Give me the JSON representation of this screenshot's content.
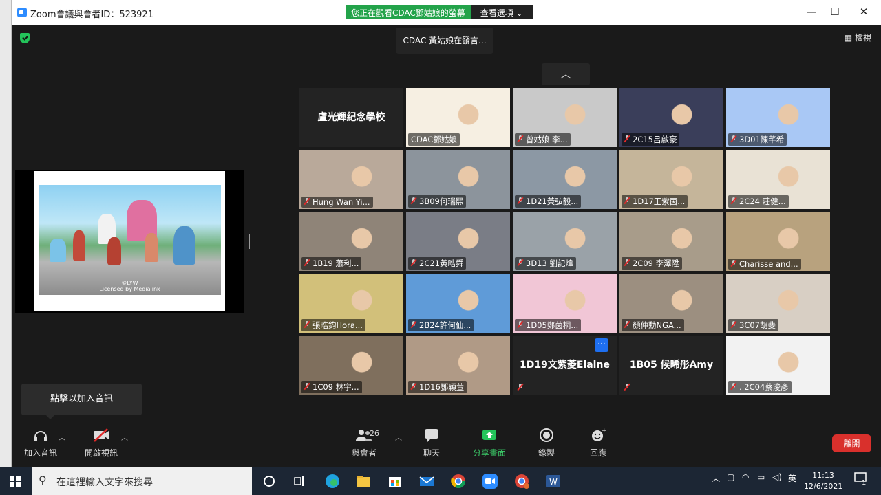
{
  "window": {
    "title": "Zoom會議與會者ID：523921",
    "minimize": "—",
    "maximize": "☐",
    "close": "✕"
  },
  "share_banner": {
    "viewing": "您正在觀看CDAC鄧姑娘的螢幕",
    "options": "查看選項 ⌄"
  },
  "speaking_indicator": "CDAC 黃姑娘在發言...",
  "view_button": "檢視",
  "shared_screen": {
    "caption_line1": "©LYW",
    "caption_line2": "Licensed by Medialink"
  },
  "participants": [
    {
      "name": "盧光輝紀念學校",
      "video": false,
      "muted": false
    },
    {
      "name": "CDAC鄧姑娘",
      "video": true,
      "muted": false,
      "active": true
    },
    {
      "name": "曾姑娘 李...",
      "video": true,
      "muted": true
    },
    {
      "name": "2C15呂啟豪",
      "video": true,
      "muted": true
    },
    {
      "name": "3D01陳芊希",
      "video": true,
      "muted": true
    },
    {
      "name": "Hung Wan Yi...",
      "video": true,
      "muted": true
    },
    {
      "name": "3B09何瑞熙",
      "video": true,
      "muted": true
    },
    {
      "name": "1D21黃弘毅...",
      "video": true,
      "muted": true
    },
    {
      "name": "1D17王紫茵...",
      "video": true,
      "muted": true
    },
    {
      "name": "2C24 莊健...",
      "video": true,
      "muted": true
    },
    {
      "name": "1B19 蕭利...",
      "video": true,
      "muted": true
    },
    {
      "name": "2C21黃晧舜",
      "video": true,
      "muted": true
    },
    {
      "name": "3D13 劉記煒",
      "video": true,
      "muted": true
    },
    {
      "name": "2C09 李澤陞",
      "video": true,
      "muted": true
    },
    {
      "name": "Charisse and...",
      "video": true,
      "muted": true
    },
    {
      "name": "張晧鈞Hora...",
      "video": true,
      "muted": true
    },
    {
      "name": "2B24許何仙...",
      "video": true,
      "muted": true
    },
    {
      "name": "1D05鄭茵桐...",
      "video": true,
      "muted": true
    },
    {
      "name": "顏仲勳NGA...",
      "video": true,
      "muted": true
    },
    {
      "name": "3C07胡斐",
      "video": true,
      "muted": true
    },
    {
      "name": "1C09 林宇...",
      "video": true,
      "muted": true
    },
    {
      "name": "1D16鄧穎萱",
      "video": true,
      "muted": true
    },
    {
      "name": "1D19文紫菱Elaine",
      "video": false,
      "muted": true,
      "more": "···"
    },
    {
      "name": "1B05 候晞彤Amy",
      "video": false,
      "muted": true
    },
    {
      "name": ". 2C04蔡浚彥",
      "video": true,
      "muted": true
    }
  ],
  "audio_tip": "點擊以加入音訊",
  "toolbar": {
    "join_audio": "加入音訊",
    "start_video": "開啟視訊",
    "participants": "與會者",
    "participant_count": "26",
    "chat": "聊天",
    "share_screen": "分享畫面",
    "record": "錄製",
    "reactions": "回應",
    "leave": "離開"
  },
  "taskbar": {
    "search_placeholder": "在這裡輸入文字來搜尋",
    "ime": "英",
    "time": "11:13",
    "date": "12/6/2021",
    "notification_count": "1"
  },
  "colors": {
    "zoom_blue": "#2d8cff",
    "share_green": "#23a34a",
    "end_red": "#d9302c",
    "active_speaker": "#e4e24a",
    "mute_red": "#e02828"
  }
}
